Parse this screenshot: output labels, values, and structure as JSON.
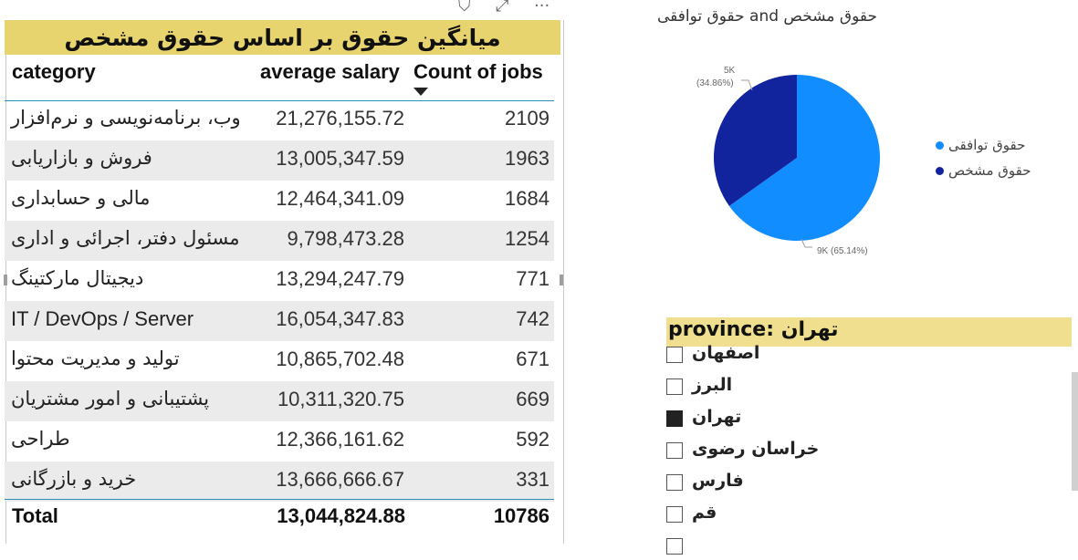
{
  "toolbar": {
    "filter_icon": "filter-icon",
    "focus_icon": "focus-mode-icon",
    "more_icon": "more-options-icon",
    "filter_glyph": "⛉",
    "focus_glyph": "⤢",
    "more_glyph": "···"
  },
  "table": {
    "title": "میانگین حقوق بر اساس حقوق مشخص",
    "columns": {
      "category": "category",
      "salary": "average salary",
      "count": "Count of jobs"
    },
    "sort": {
      "column": "Count of jobs",
      "direction": "descending"
    },
    "rows": [
      {
        "category": "وب، برنامه‌نویسی و نرم‌افزار",
        "salary": "21,276,155.72",
        "count": "2109"
      },
      {
        "category": "فروش و بازاریابی",
        "salary": "13,005,347.59",
        "count": "1963"
      },
      {
        "category": "مالی و حسابداری",
        "salary": "12,464,341.09",
        "count": "1684"
      },
      {
        "category": "مسئول دفتر، اجرائی و اداری",
        "salary": "9,798,473.28",
        "count": "1254"
      },
      {
        "category": "دیجیتال مارکتینگ",
        "salary": "13,294,247.79",
        "count": "771"
      },
      {
        "category": "IT / DevOps / Server",
        "salary": "16,054,347.83",
        "count": "742"
      },
      {
        "category": "تولید و مدیریت محتوا",
        "salary": "10,865,702.48",
        "count": "671"
      },
      {
        "category": "پشتیبانی و امور مشتریان",
        "salary": "10,311,320.75",
        "count": "669"
      },
      {
        "category": "طراحی",
        "salary": "12,366,161.62",
        "count": "592"
      },
      {
        "category": "خرید و بازرگانی",
        "salary": "13,666,666.67",
        "count": "331"
      }
    ],
    "total": {
      "label": "Total",
      "salary": "13,044,824.88",
      "count": "10786"
    }
  },
  "pie": {
    "title": "حقوق مشخص and حقوق توافقی",
    "slice_labels": {
      "small_value": "5K",
      "small_pct": "(34.86%)",
      "large": "9K (65.14%)"
    },
    "legend": [
      {
        "label": "حقوق توافقی",
        "color": "#118dff"
      },
      {
        "label": "حقوق مشخص",
        "color": "#12239e"
      }
    ]
  },
  "chart_data": {
    "type": "pie",
    "title": "حقوق مشخص and حقوق توافقی",
    "categories": [
      "حقوق توافقی",
      "حقوق مشخص"
    ],
    "values": [
      9,
      5
    ],
    "value_labels": [
      "9K",
      "5K"
    ],
    "percentages": [
      65.14,
      34.86
    ],
    "colors": [
      "#118dff",
      "#12239e"
    ],
    "legend_position": "right"
  },
  "slicer": {
    "header": "province: تهران",
    "items": [
      {
        "label": "اصفهان",
        "checked": false
      },
      {
        "label": "البرز",
        "checked": false
      },
      {
        "label": "تهران",
        "checked": true
      },
      {
        "label": "خراسان رضوی",
        "checked": false
      },
      {
        "label": "فارس",
        "checked": false
      },
      {
        "label": "قم",
        "checked": false
      }
    ]
  }
}
